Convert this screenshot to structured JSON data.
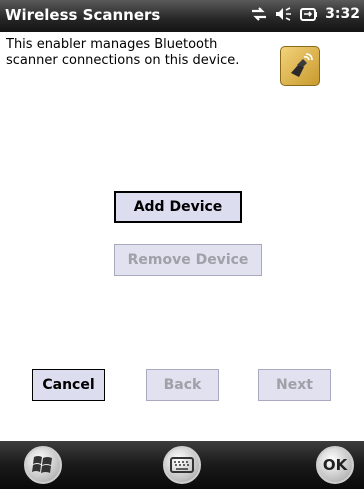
{
  "titlebar": {
    "title": "Wireless Scanners",
    "time": "3:32"
  },
  "content": {
    "description": "This enabler manages Bluetooth scanner connections on this device.",
    "buttons": {
      "add_device": "Add Device",
      "remove_device": "Remove Device",
      "cancel": "Cancel",
      "back": "Back",
      "next": "Next"
    }
  },
  "softkeys": {
    "ok": "OK"
  },
  "icons": {
    "status": [
      "network-icon",
      "speaker-icon",
      "battery-icon"
    ],
    "app": "scanner-icon",
    "start": "windows-start-icon",
    "keyboard": "keyboard-icon"
  },
  "colors": {
    "button_bg": "#ddddf0",
    "disabled_text": "#a0a0a8",
    "accent_icon": "#d4a93a"
  }
}
